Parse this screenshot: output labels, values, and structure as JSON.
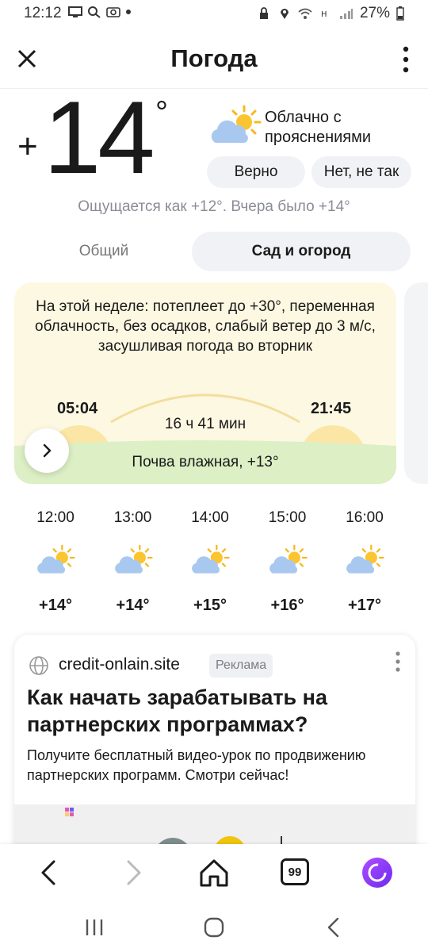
{
  "status_bar": {
    "time": "12:12",
    "battery": "27%",
    "icons_left": [
      "screen-cast-icon",
      "search-icon",
      "camera-icon",
      "dot-icon"
    ],
    "icons_right": [
      "lock-icon",
      "location-icon",
      "wifi-icon",
      "data-icon",
      "signal-icon",
      "battery-icon"
    ]
  },
  "app_bar": {
    "title": "Погода",
    "close_icon": "close-icon",
    "menu_icon": "more-vertical-icon"
  },
  "current": {
    "sign": "+",
    "temperature": "14",
    "degree": "°",
    "condition": "Облачно с прояснениями",
    "condition_icon": "partly-cloudy-icon",
    "feedback_yes": "Верно",
    "feedback_no": "Нет, не так",
    "feels_like": "Ощущается как +12°. Вчера было +14°"
  },
  "tabs": {
    "general": "Общий",
    "garden": "Сад и огород",
    "active": "garden"
  },
  "garden_card": {
    "summary": "На этой неделе: потеплеет до +30°, переменная облачность, без осадков, слабый ветер до 3 м/с, засушливая погода во вторник",
    "sunrise": "05:04",
    "sunset": "21:45",
    "day_length": "16 ч 41 мин",
    "soil": "Почва влажная, +13°",
    "colors": {
      "background": "#fdf8e2",
      "grass": "#dcefc5",
      "sun": "#fce6a6"
    }
  },
  "hourly": [
    {
      "time": "12:00",
      "temp": "+14°",
      "icon": "partly-cloudy-icon"
    },
    {
      "time": "13:00",
      "temp": "+14°",
      "icon": "partly-cloudy-icon"
    },
    {
      "time": "14:00",
      "temp": "+15°",
      "icon": "partly-cloudy-icon"
    },
    {
      "time": "15:00",
      "temp": "+16°",
      "icon": "partly-cloudy-icon"
    },
    {
      "time": "16:00",
      "temp": "+17°",
      "icon": "partly-cloudy-icon"
    }
  ],
  "ad": {
    "domain": "credit-onlain.site",
    "badge": "Реклама",
    "headline": "Как начать зарабатывать на партнерских программах?",
    "body": "Получите бесплатный видео-урок по продвижению партнерских программ. Смотри сейчас!"
  },
  "browser_bar": {
    "back_icon": "back-arrow-icon",
    "forward_icon": "forward-arrow-icon",
    "home_icon": "home-icon",
    "tabs_count": "99",
    "assistant_icon": "alice-assistant-icon"
  },
  "system_nav": {
    "recents_icon": "recents-icon",
    "home_icon": "home-circle-icon",
    "back_icon": "back-chevron-icon"
  }
}
